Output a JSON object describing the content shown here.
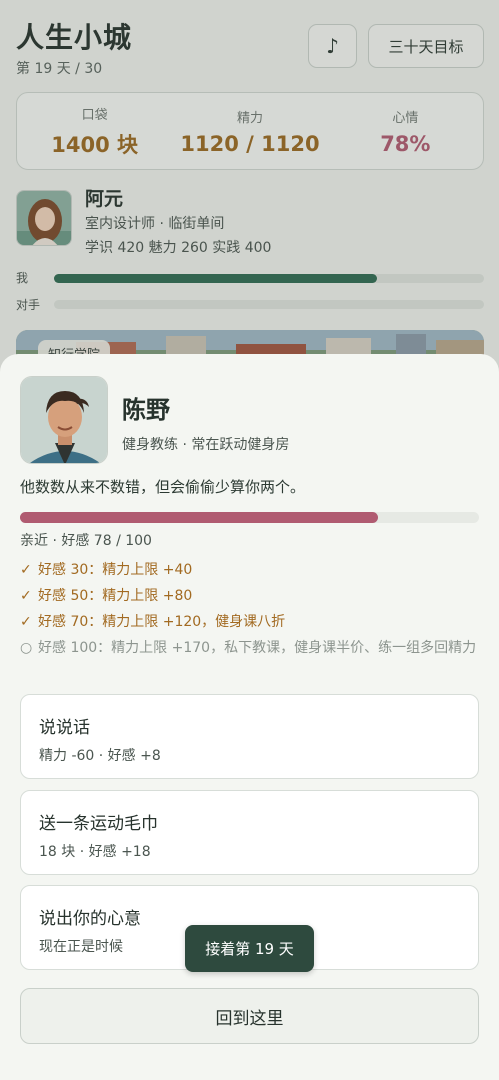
{
  "header": {
    "title": "人生小城",
    "day_text": "第 19 天 / 30",
    "music_label": "♪",
    "goal_label": "三十天目标"
  },
  "stats": [
    {
      "label": "口袋",
      "value": "1400 块",
      "color": "#9a6a22"
    },
    {
      "label": "精力",
      "value": "1120 / 1120",
      "color": "#9a6a22"
    },
    {
      "label": "心情",
      "value": "78%",
      "color": "#b05b71"
    }
  ],
  "player": {
    "name": "阿元",
    "role": "室内设计师 · 临街单间",
    "attributes": "学识 420 魅力 260 实践 400"
  },
  "race": {
    "me_label": "我",
    "me_progress": 0.75,
    "rival_label": "对手",
    "rival_progress": 0
  },
  "scene": {
    "chip_label": "知行学院"
  },
  "npc": {
    "name": "陈野",
    "role": "健身教练 · 常在跃动健身房",
    "quote": "他数数从来不数错，但会偷偷少算你两个。",
    "affection": 78,
    "affection_max": 100,
    "status": "亲近 · 好感 78 / 100",
    "milestones": [
      {
        "icon": "✓",
        "done": true,
        "text": "好感 30：精力上限 +40"
      },
      {
        "icon": "✓",
        "done": true,
        "text": "好感 50：精力上限 +80"
      },
      {
        "icon": "✓",
        "done": true,
        "text": "好感 70：精力上限 +120，健身课八折"
      },
      {
        "icon": "○",
        "done": false,
        "text": "好感 100：精力上限 +170，私下教课，健身课半价、练一组多回精力"
      }
    ]
  },
  "actions": [
    {
      "title": "说说话",
      "sub": "精力 -60 · 好感 +8"
    },
    {
      "title": "送一条运动毛巾",
      "sub": "18 块 · 好感 +18"
    },
    {
      "title": "说出你的心意",
      "sub": "现在正是时候"
    }
  ],
  "return_label": "回到这里",
  "toast": "接着第 19 天"
}
